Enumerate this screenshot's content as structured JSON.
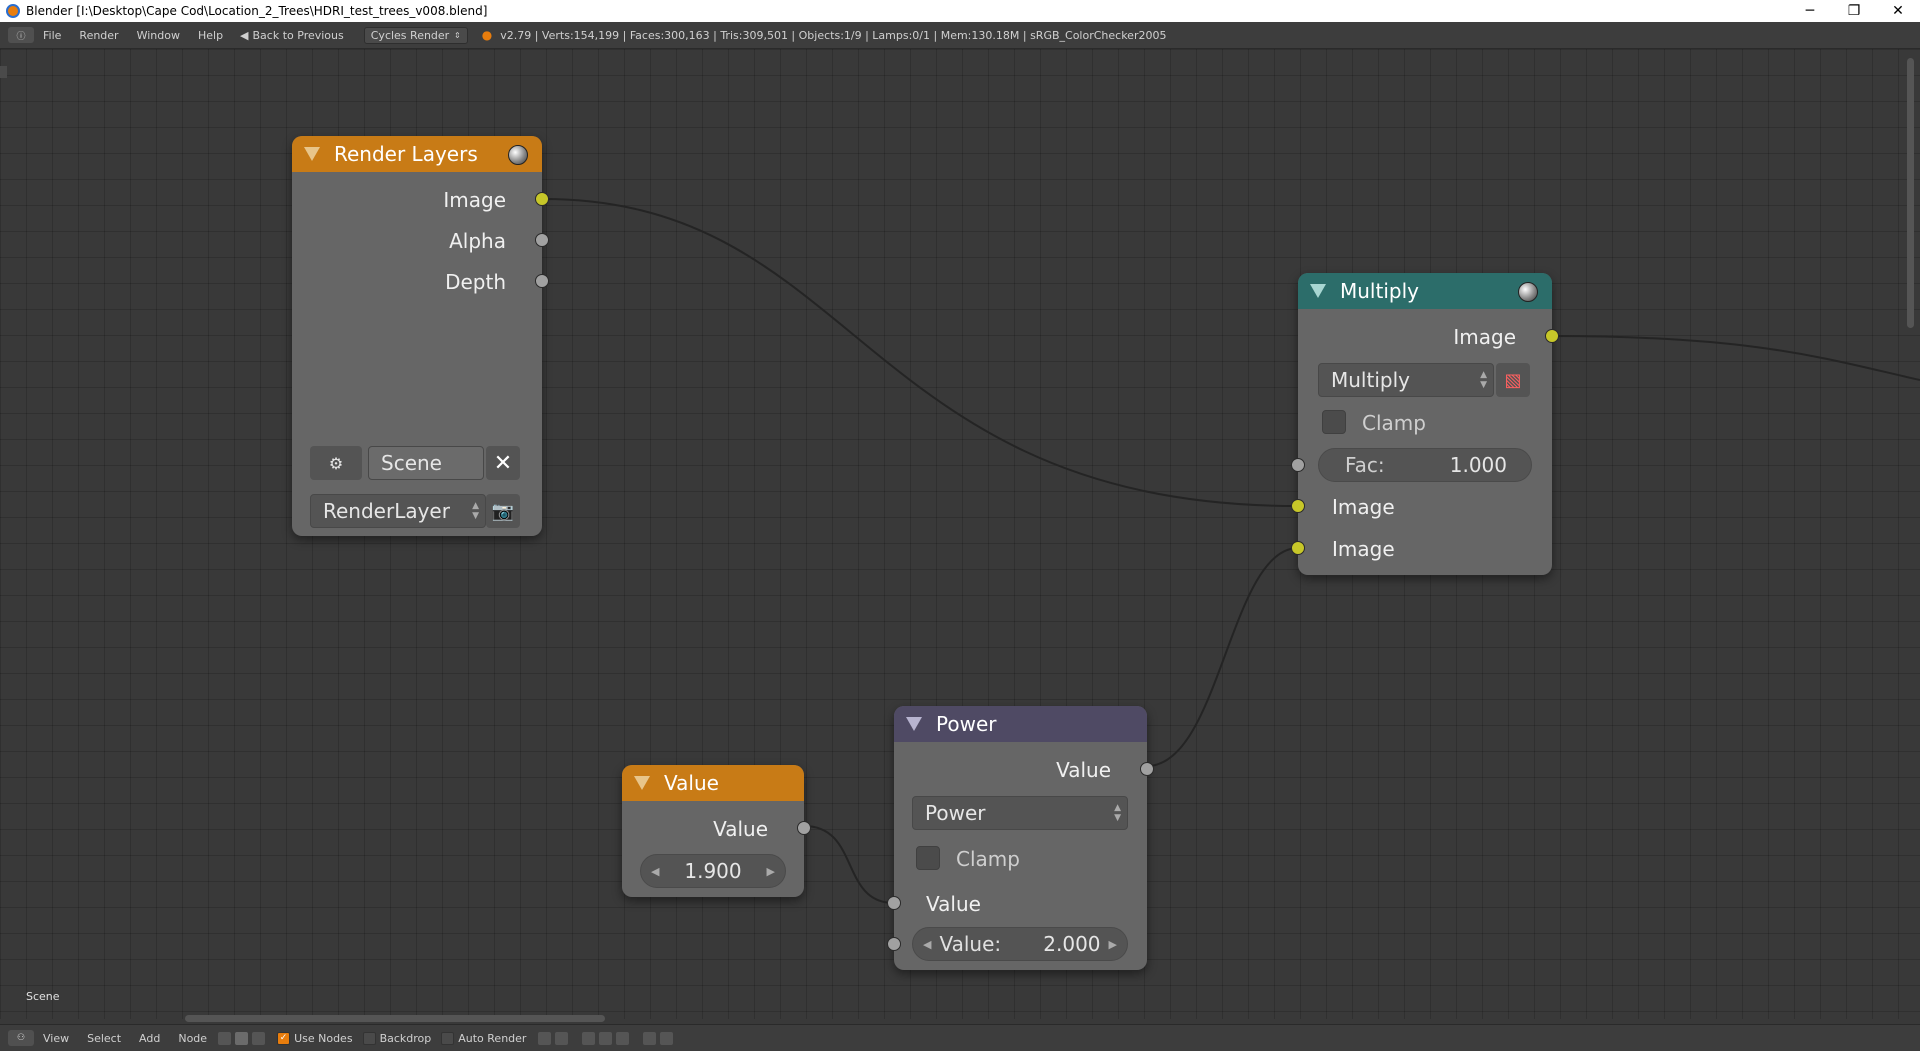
{
  "window": {
    "title": "Blender [I:\\Desktop\\Cape Cod\\Location_2_Trees\\HDRI_test_trees_v008.blend]",
    "minimize": "─",
    "restore": "❐",
    "close": "✕"
  },
  "infobar": {
    "menus": [
      "File",
      "Render",
      "Window",
      "Help"
    ],
    "back_label": "Back to Previous",
    "render_engine": "Cycles Render",
    "stats": "v2.79 | Verts:154,199 | Faces:300,163 | Tris:309,501 | Objects:1/9 | Lamps:0/1 | Mem:130.18M | sRGB_ColorChecker2005"
  },
  "editor": {
    "scene_label": "Scene"
  },
  "nodes": {
    "render_layers": {
      "title": "Render Layers",
      "outputs": [
        "Image",
        "Alpha",
        "Depth"
      ],
      "scene": "Scene",
      "layer": "RenderLayer"
    },
    "multiply": {
      "title": "Multiply",
      "output": "Image",
      "blend_type": "Multiply",
      "clamp_label": "Clamp",
      "fac_label": "Fac:",
      "fac_value": "1.000",
      "inputs": [
        "Image",
        "Image"
      ]
    },
    "value": {
      "title": "Value",
      "output": "Value",
      "value": "1.900"
    },
    "power": {
      "title": "Power",
      "output": "Value",
      "operation": "Power",
      "clamp_label": "Clamp",
      "input1": "Value",
      "input2_label": "Value:",
      "input2_value": "2.000"
    }
  },
  "bottombar": {
    "menus": [
      "View",
      "Select",
      "Add",
      "Node"
    ],
    "use_nodes": "Use Nodes",
    "backdrop": "Backdrop",
    "auto_render": "Auto Render"
  },
  "colors": {
    "input_header": "#c87b16",
    "color_header": "#2c6d6a",
    "converter_header": "#4f4a64",
    "socket_color": "#c7c729",
    "socket_value": "#a1a1a1"
  }
}
